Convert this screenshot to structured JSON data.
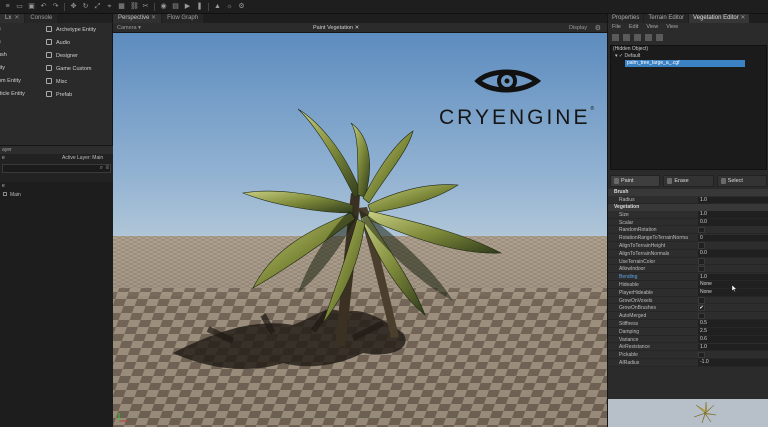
{
  "toolbar": {
    "icons": [
      "menu-icon",
      "file-icon",
      "save-icon",
      "undo-icon",
      "redo-icon",
      "move-icon",
      "rotate-icon",
      "scale-icon",
      "snap-icon",
      "grid-icon",
      "link-icon",
      "unlink-icon",
      "camera-icon",
      "lock-icon",
      "play-icon",
      "pause-icon",
      "terrain-icon",
      "sun-icon",
      "settings-icon"
    ]
  },
  "left_panel": {
    "tabs": [
      {
        "label": "Lx"
      },
      {
        "label": "Console"
      }
    ],
    "entities": [
      {
        "label": "s",
        "col": 0
      },
      {
        "label": "Archetype Entity",
        "col": 1
      },
      {
        "label": "s",
        "col": 0
      },
      {
        "label": "Audio",
        "col": 1
      },
      {
        "label": "ush",
        "col": 0
      },
      {
        "label": "Designer",
        "col": 1
      },
      {
        "label": "tity",
        "col": 0
      },
      {
        "label": "Game Custom",
        "col": 1
      },
      {
        "label": "om Entity",
        "col": 0
      },
      {
        "label": "Misc",
        "col": 1
      },
      {
        "label": "rticle Entity",
        "col": 0
      },
      {
        "label": "Prefab",
        "col": 1
      }
    ],
    "layer": {
      "header": "ayer",
      "subheader": "e",
      "active_layer": "Active Layer: Main",
      "list": [
        {
          "label": "e"
        },
        {
          "label": "Main"
        }
      ]
    }
  },
  "viewport": {
    "tabs": [
      {
        "label": "Perspective",
        "active": true
      },
      {
        "label": "Flow Graph",
        "active": false
      }
    ],
    "camera_label": "Camera",
    "title": "Paint Vegetation",
    "display_label": "Display",
    "logo_text": "CRYENGINE",
    "logo_mark": "®"
  },
  "right_panel": {
    "tabs": [
      {
        "label": "Properties",
        "active": false
      },
      {
        "label": "Terrain Editor",
        "active": false
      },
      {
        "label": "Vegetation Editor",
        "active": true
      }
    ],
    "menu": [
      "File",
      "Edit",
      "View",
      "View"
    ],
    "tree": [
      {
        "label": "(Hidden Object)",
        "selected": false
      },
      {
        "label": "▾  ✓  Default",
        "selected": false
      },
      {
        "label": "palm_tree_large_a_.cgf",
        "selected": true
      }
    ],
    "modes": [
      {
        "label": "Paint",
        "active": true
      },
      {
        "label": "Erase",
        "active": false
      },
      {
        "label": "Select",
        "active": false
      }
    ],
    "sections": [
      {
        "title": "Brush",
        "rows": [
          {
            "label": "Radius",
            "value": "1.0"
          }
        ]
      },
      {
        "title": "Vegetation",
        "rows": [
          {
            "label": "Size",
            "value": "1.0"
          },
          {
            "label": "Scalar",
            "value": "0.0"
          },
          {
            "label": "RandomRotation",
            "check": ""
          },
          {
            "label": "RotationRangeToTerrainNorma",
            "value": "0"
          },
          {
            "label": "AlignToTerrainHeight",
            "check": ""
          },
          {
            "label": "AlignToTerrainNormals",
            "value": "0.0"
          },
          {
            "label": "UseTerrainColor",
            "check": ""
          },
          {
            "label": "AllowIndoor",
            "check": ""
          },
          {
            "label": "Bending",
            "value": "1.0",
            "highlight": true
          },
          {
            "label": "Hideable",
            "value": "None"
          },
          {
            "label": "PlayerHideable",
            "value": "None"
          },
          {
            "label": "GrowOnVoxels",
            "check": ""
          },
          {
            "label": "GrowOnBrushes",
            "check": "✔"
          },
          {
            "label": "AutoMerged",
            "check": ""
          },
          {
            "label": "Stiffness",
            "value": "0.5"
          },
          {
            "label": "Damping",
            "value": "2.5"
          },
          {
            "label": "Variance",
            "value": "0.6"
          },
          {
            "label": "AirResistance",
            "value": "1.0"
          },
          {
            "label": "Pickable",
            "check": ""
          },
          {
            "label": "AIRadius",
            "value": "-1.0"
          }
        ]
      }
    ]
  },
  "colors": {
    "accent": "#3b82c4",
    "sky_top": "#6a96c4",
    "sky_bottom": "#a9c3d8",
    "ground": "#8d7e6d"
  }
}
